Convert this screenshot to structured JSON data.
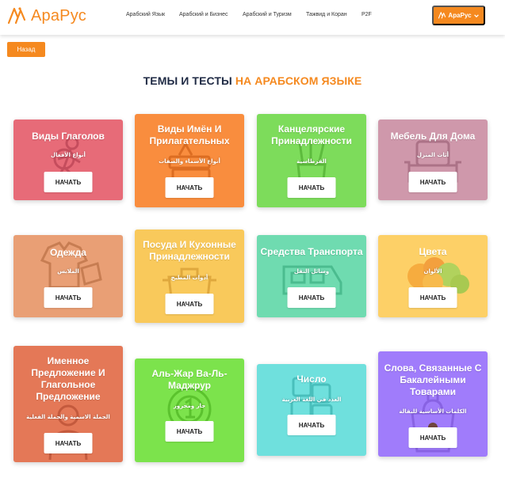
{
  "header": {
    "logo_text": "АраРус",
    "nav": [
      {
        "label": "Арабский Язык"
      },
      {
        "label": "Арабский и Бизнес"
      },
      {
        "label": "Арабский и Туризм"
      },
      {
        "label": "Тажвид и Коран"
      },
      {
        "label": "P2F"
      }
    ],
    "account_label": "АраРус"
  },
  "back_label": "Назад",
  "page_title": {
    "part1": "ТЕМЫ И ТЕСТЫ ",
    "part2": "НА АРАБСКОМ ЯЗЫКЕ"
  },
  "start_label": "НАЧАТЬ",
  "colors": {
    "brand": "#f5891f",
    "title_dark": "#1f2a44"
  },
  "cards": [
    {
      "title": "Виды Глаголов",
      "arabic": "أنواع الأفعال",
      "color": "#e76b78",
      "icon": "running-person-icon"
    },
    {
      "title": "Виды Имён И Прилагательных",
      "arabic": "أنواع الأسماء والصفات",
      "color": "#f98d3e",
      "icon": "book-stack-icon"
    },
    {
      "title": "Канцелярские Принадлежности",
      "arabic": "القرطاسية",
      "color": "#7ddc5b",
      "icon": "pencil-cup-icon"
    },
    {
      "title": "Мебель Для Дома",
      "arabic": "أثاث المنزل",
      "color": "#cf98ab",
      "icon": "armchair-icon"
    },
    {
      "title": "Одежда",
      "arabic": "الملابس",
      "color": "#e99f75",
      "icon": "clothes-icon"
    },
    {
      "title": "Посуда И Кухонные Принадлежности",
      "arabic": "أدوات المطبخ",
      "color": "#f9c95b",
      "icon": "kitchen-pot-icon"
    },
    {
      "title": "Средства Транспорта",
      "arabic": "وسائل النقل",
      "color": "#6fdbb0",
      "icon": "train-icon"
    },
    {
      "title": "Цвета",
      "arabic": "الألوان",
      "color": "#fdd067",
      "icon": "color-circles-icon"
    },
    {
      "title": "Именное Предложение И Глагольное Предложение",
      "arabic": "الجملة الاسمية والجملة الفعلية",
      "color": "#e47857",
      "icon": "person-icon"
    },
    {
      "title": "Аль-Жар Ва-Ль-Маджрур",
      "arabic": "جار ومجرور",
      "color": "#7ce34c",
      "icon": "medal-icon"
    },
    {
      "title": "Число",
      "arabic": "العدد في اللغة العربية",
      "color": "#6fe0dd",
      "icon": "number-blocks-icon"
    },
    {
      "title": "Слова, Связанные С Бакалейными Товарами",
      "arabic": "الكلمات الأساسية للبقالة",
      "color": "#a07cfb",
      "icon": "grocery-bag-icon"
    }
  ]
}
